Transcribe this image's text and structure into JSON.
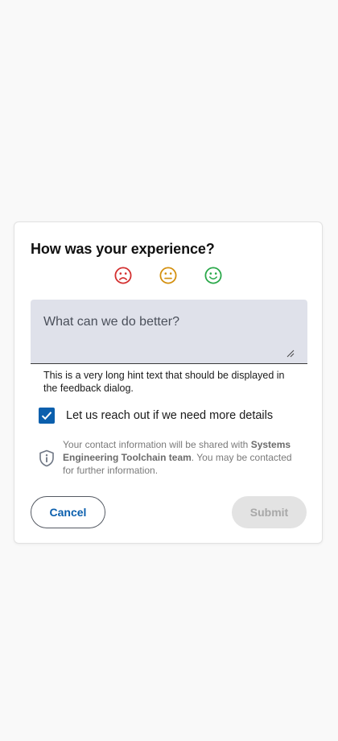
{
  "dialog": {
    "title": "How was your experience?",
    "ratings": [
      {
        "icon": "sad-face-icon",
        "color": "#d32f2f"
      },
      {
        "icon": "neutral-face-icon",
        "color": "#d4900f"
      },
      {
        "icon": "happy-face-icon",
        "color": "#2aa84a"
      }
    ],
    "feedback": {
      "placeholder": "What can we do better?",
      "value": ""
    },
    "hint": "This is a very long hint text that should be displayed in the feedback dialog.",
    "contact_checkbox": {
      "label": "Let us reach out if we need more details",
      "checked": true
    },
    "info": {
      "icon": "shield-info-icon",
      "text_before": "Your contact information will be shared with ",
      "team": "Systems Engineering Toolchain team",
      "text_after": ". You may be contacted for further information."
    },
    "buttons": {
      "cancel_label": "Cancel",
      "submit_label": "Submit"
    },
    "colors": {
      "accent": "#0b5fad",
      "field_background": "#dfe1ea",
      "submit_disabled": "#e3e3e3"
    }
  }
}
